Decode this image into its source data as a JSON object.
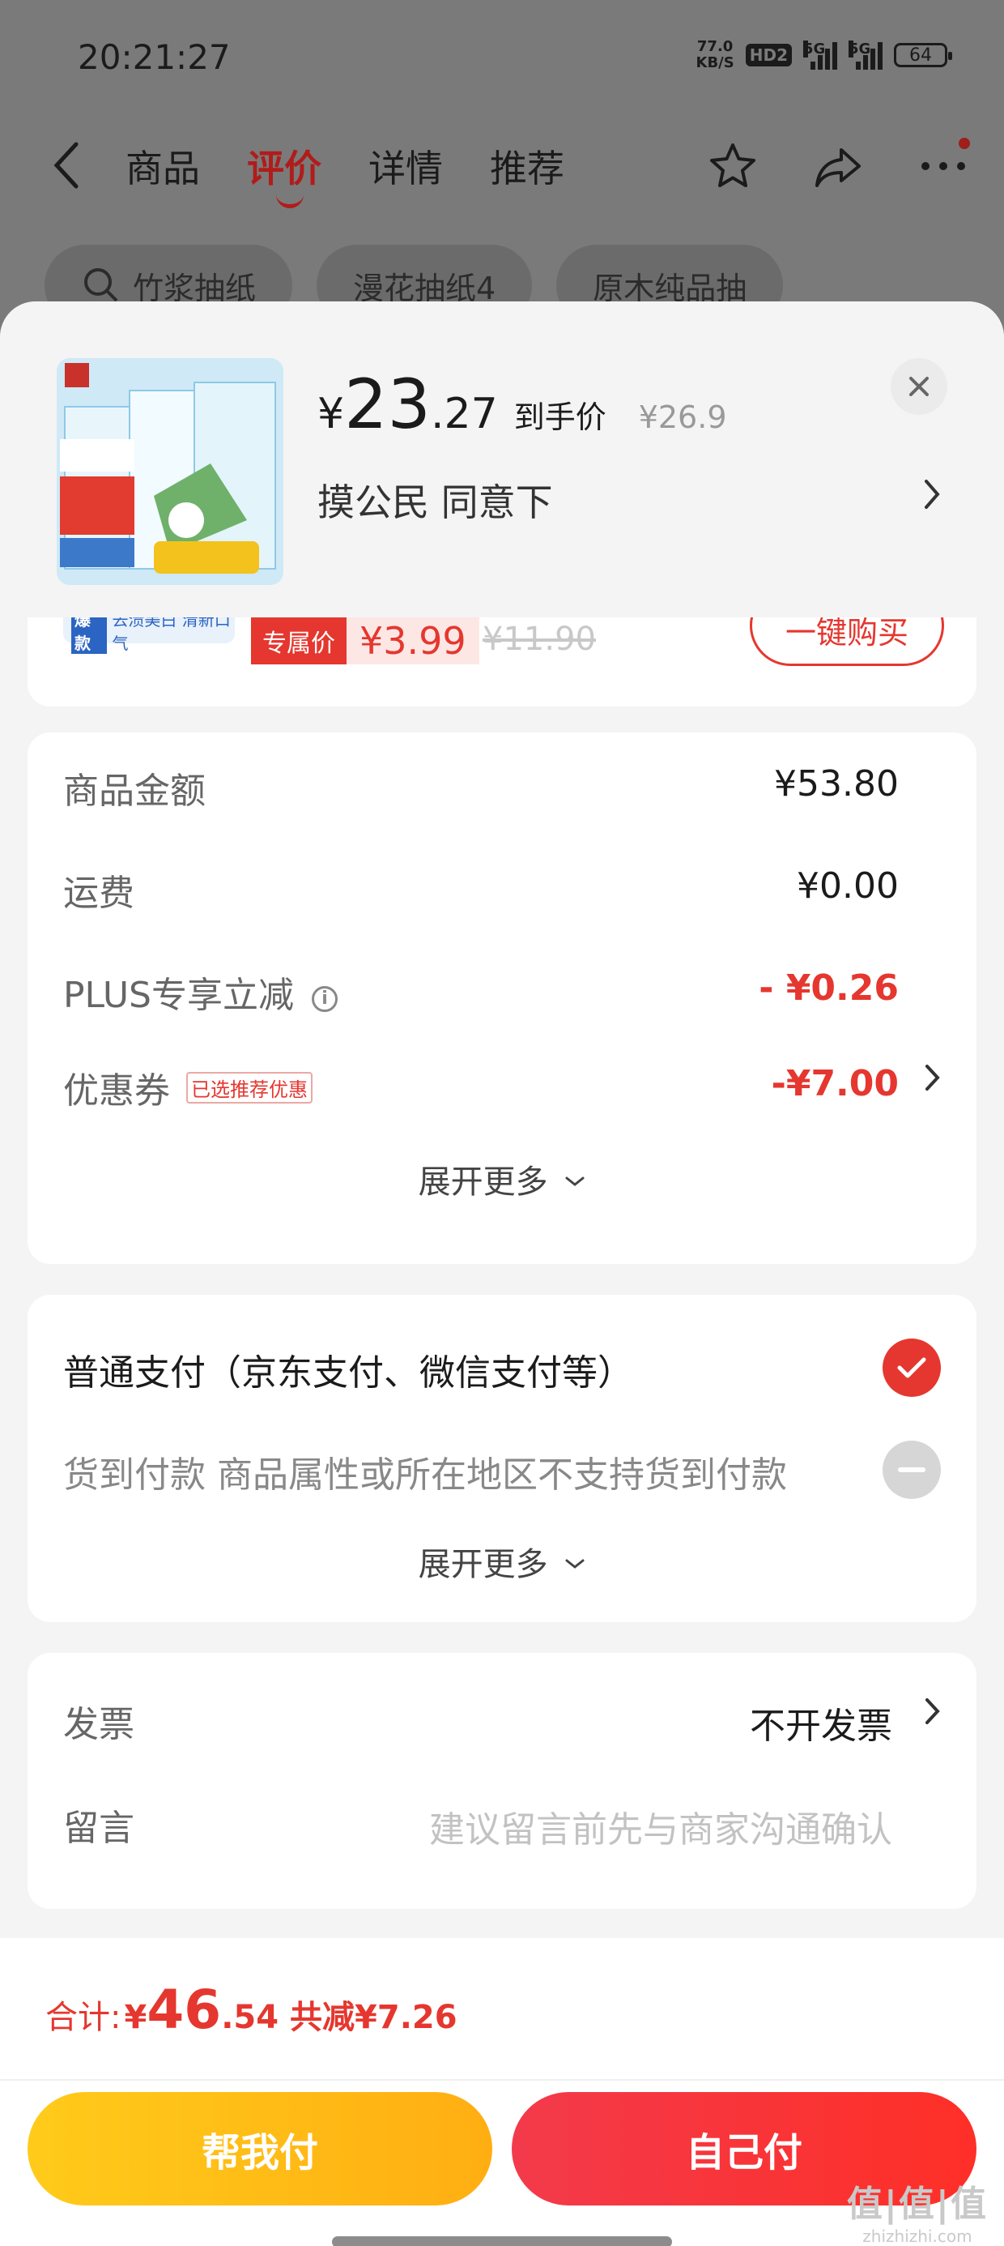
{
  "status_bar": {
    "time": "20:21:27",
    "net_speed": "77.0",
    "net_unit": "KB/S",
    "hd": "HD2",
    "sig1": "5G",
    "sig2": "5G",
    "battery": "64"
  },
  "nav": {
    "tabs": [
      "商品",
      "评价",
      "详情",
      "推荐"
    ],
    "active_tab": "评价"
  },
  "search_chips": [
    "竹浆抽纸",
    "漫花抽纸4",
    "原木纯品抽"
  ],
  "product": {
    "price_yen": "¥",
    "price_int": "23",
    "price_dec": ".27",
    "price_label": "到手价",
    "orig_price": "¥26.9",
    "address": "摸公民  同意下"
  },
  "prev_item": {
    "badge_hot": "爆款",
    "badge_text": "去渍美白 清新口气",
    "tag_label": "专属价",
    "tag_price": "¥3.99",
    "old_price": "¥11.90",
    "button_label": "一键购买"
  },
  "fees": {
    "goods_label": "商品金额",
    "goods_value": "¥53.80",
    "shipping_label": "运费",
    "shipping_value": "¥0.00",
    "plus_label": "PLUS专享立减",
    "plus_value": "- ¥0.26",
    "coupon_label": "优惠券",
    "coupon_tag": "已选推荐优惠",
    "coupon_value": "-¥7.00",
    "expand": "展开更多"
  },
  "payment": {
    "normal": "普通支付（京东支付、微信支付等）",
    "cod": "货到付款 商品属性或所在地区不支持货到付款",
    "expand": "展开更多"
  },
  "invoice": {
    "label": "发票",
    "value": "不开发票",
    "note_label": "留言",
    "note_placeholder": "建议留言前先与商家沟通确认"
  },
  "footer": {
    "total_label": "合计:",
    "total_yen": "¥",
    "total_int": "46",
    "total_dec": ".54",
    "saved": "共减¥7.26",
    "help_pay": "帮我付",
    "self_pay": "自己付"
  },
  "watermark": {
    "main": "值|值|值",
    "sub": "zhizhizhi.com"
  },
  "colors": {
    "accent_red": "#e5372f",
    "tab_active": "#b01c1a",
    "help_pay_yellow": "#ffb814",
    "sheet_bg": "#f4f4f4"
  },
  "icons": [
    "back-icon",
    "star-icon",
    "share-icon",
    "more-icon",
    "search-icon",
    "close-icon",
    "chevron-right-icon",
    "info-icon",
    "check-icon",
    "disabled-icon",
    "chevron-down-icon"
  ]
}
